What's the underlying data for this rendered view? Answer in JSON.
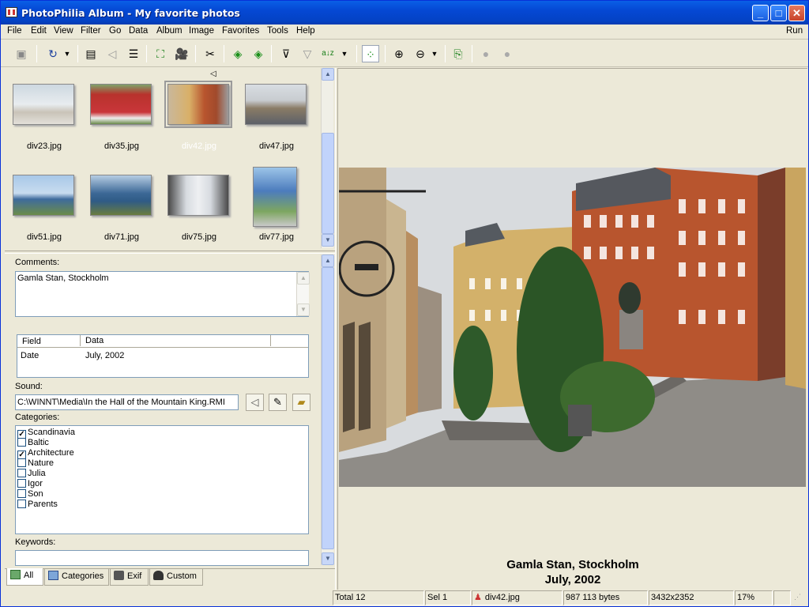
{
  "window": {
    "title": "PhotoPhilia Album - My favorite photos"
  },
  "menu": {
    "items": [
      "File",
      "Edit",
      "View",
      "Filter",
      "Go",
      "Data",
      "Album",
      "Image",
      "Favorites",
      "Tools",
      "Help"
    ],
    "run": "Run"
  },
  "thumbnails": [
    {
      "file": "div23.jpg"
    },
    {
      "file": "div35.jpg"
    },
    {
      "file": "div42.jpg",
      "selected": true
    },
    {
      "file": "div47.jpg"
    },
    {
      "file": "div51.jpg"
    },
    {
      "file": "div71.jpg"
    },
    {
      "file": "div75.jpg"
    },
    {
      "file": "div77.jpg"
    }
  ],
  "properties": {
    "comments_label": "Comments:",
    "comments_value": "Gamla Stan, Stockholm",
    "grid": {
      "headers": [
        "Field",
        "Data"
      ],
      "rows": [
        {
          "field": "Date",
          "data": "July, 2002"
        }
      ]
    },
    "sound_label": "Sound:",
    "sound_value": "C:\\WINNT\\Media\\In the Hall of the Mountain King.RMI",
    "categories_label": "Categories:",
    "categories": [
      {
        "name": "Scandinavia",
        "checked": true
      },
      {
        "name": "Baltic",
        "checked": false
      },
      {
        "name": "Architecture",
        "checked": true
      },
      {
        "name": "Nature",
        "checked": false
      },
      {
        "name": "Julia",
        "checked": false
      },
      {
        "name": "Igor",
        "checked": false
      },
      {
        "name": "Son",
        "checked": false
      },
      {
        "name": "Parents",
        "checked": false
      }
    ],
    "keywords_label": "Keywords:"
  },
  "tabs": [
    "All",
    "Categories",
    "Exif",
    "Custom"
  ],
  "viewer": {
    "caption_line1": "Gamla Stan, Stockholm",
    "caption_line2": "July, 2002"
  },
  "status": {
    "total": "Total 12",
    "sel": "Sel 1",
    "file": "div42.jpg",
    "size": "987 113 bytes",
    "dims": "3432x2352",
    "zoom": "17%"
  },
  "colors": {
    "title_bar": "#0548d4",
    "selection_frame": "#808080",
    "window_bg": "#ece9d8"
  }
}
